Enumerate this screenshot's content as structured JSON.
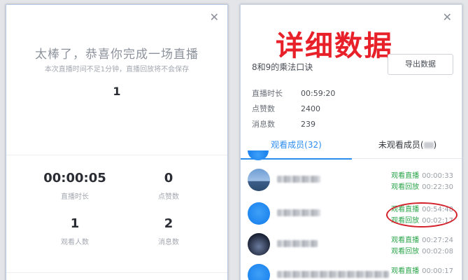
{
  "left": {
    "congrats": "太棒了，恭喜你完成一场直播",
    "subnote": "本次直播时间不足1分钟，直播回放将不会保存",
    "top_number": "1",
    "stats": [
      {
        "value": "00:00:05",
        "label": "直播时长"
      },
      {
        "value": "0",
        "label": "点赞数"
      },
      {
        "value": "1",
        "label": "观看人数"
      },
      {
        "value": "2",
        "label": "消息数"
      }
    ]
  },
  "right": {
    "annotation_title": "详细数据",
    "course_title": "8和9的乘法口诀",
    "export_label": "导出数据",
    "info": [
      {
        "key": "直播时长",
        "value": "00:59:20"
      },
      {
        "key": "点赞数",
        "value": "2400"
      },
      {
        "key": "消息数",
        "value": "239"
      }
    ],
    "tabs": {
      "watched": "观看成员(32)",
      "unwatched": "未观看成员("
    },
    "members": [
      {
        "live_tag": "观看直播",
        "live_time": "00:00:33",
        "replay_tag": "观看回放",
        "replay_time": "00:22:30"
      },
      {
        "live_tag": "观看直播",
        "live_time": "00:54:48",
        "replay_tag": "观看回放",
        "replay_time": "00:02:17"
      },
      {
        "live_tag": "观看直播",
        "live_time": "00:27:24",
        "replay_tag": "观看回放",
        "replay_time": "00:02:08"
      },
      {
        "live_tag": "观看直播",
        "live_time": "00:00:17",
        "replay_tag": "",
        "replay_time": ""
      }
    ]
  },
  "colors": {
    "accent": "#2c8df0",
    "green": "#2aa44a",
    "annotation_red": "#e8202a"
  }
}
